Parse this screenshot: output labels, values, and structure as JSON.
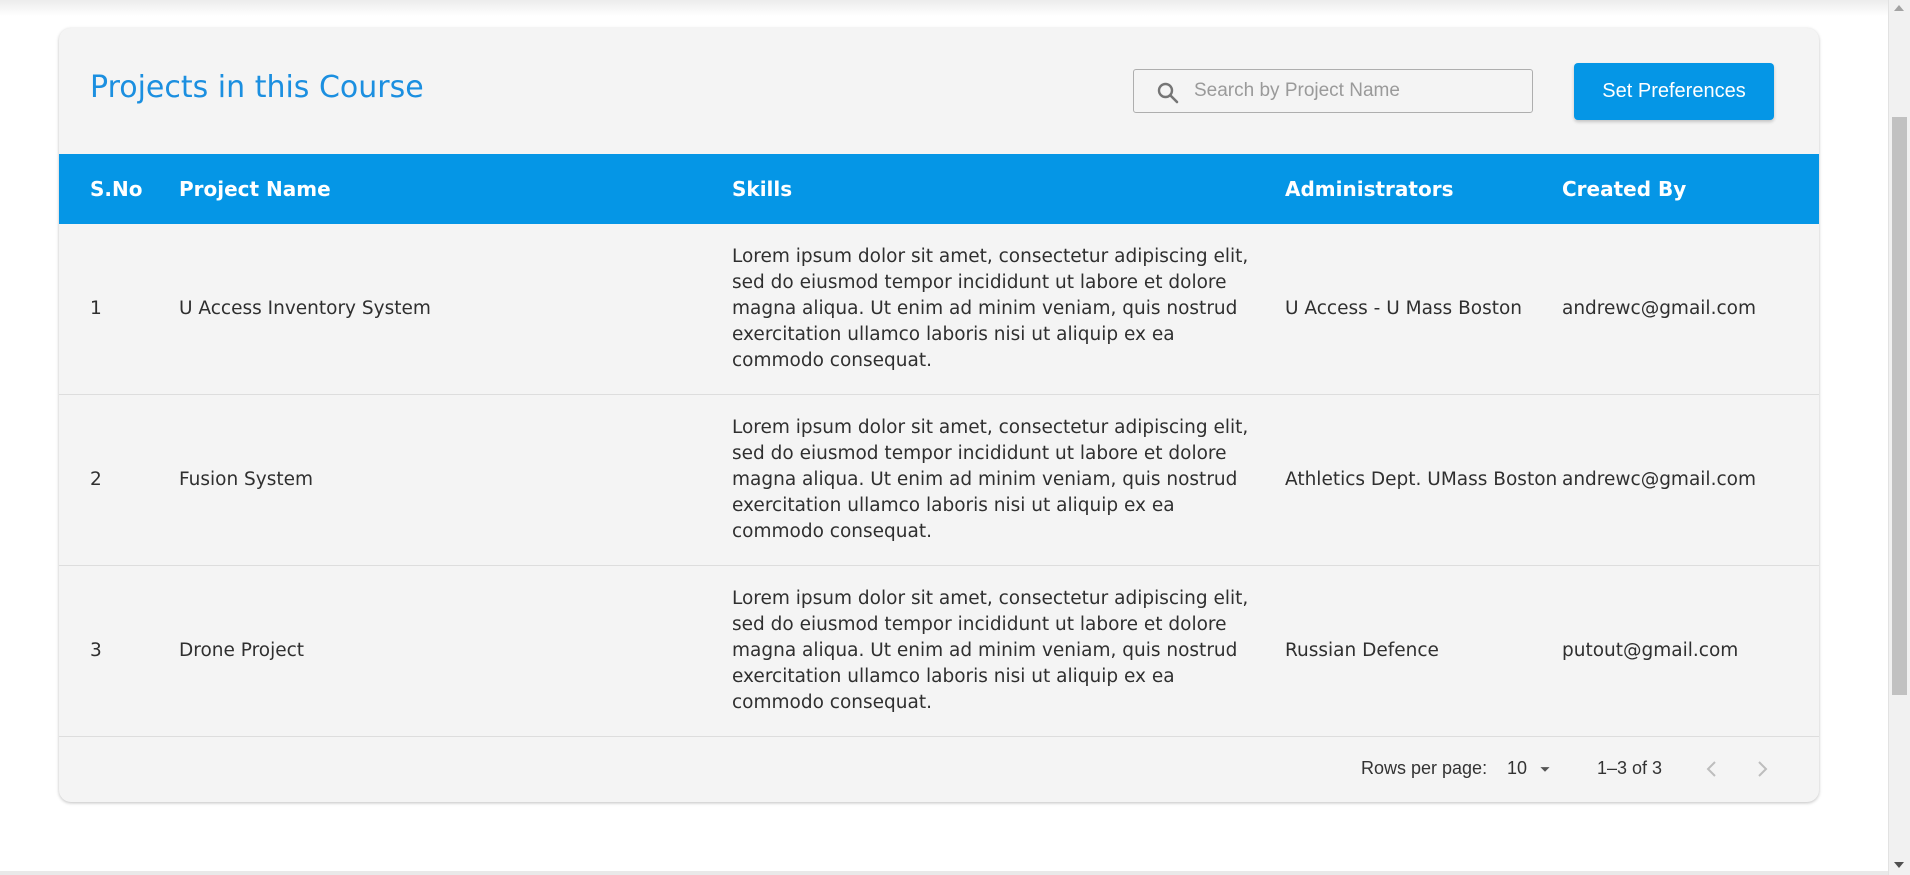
{
  "header": {
    "title": "Projects in this Course",
    "search_placeholder": "Search by Project Name",
    "search_value": "",
    "preferences_button": "Set Preferences"
  },
  "table": {
    "columns": [
      "S.No",
      "Project Name",
      "Skills",
      "Administrators",
      "Created By"
    ],
    "rows": [
      {
        "sno": "1",
        "project_name": "U Access Inventory System",
        "skills": "Lorem ipsum dolor sit amet, consectetur adipiscing elit, sed do eiusmod tempor incididunt ut labore et dolore magna aliqua. Ut enim ad minim veniam, quis nostrud exercitation ullamco laboris nisi ut aliquip ex ea commodo consequat.",
        "administrators": "U Access - U Mass Boston",
        "created_by": "andrewc@gmail.com"
      },
      {
        "sno": "2",
        "project_name": "Fusion System",
        "skills": "Lorem ipsum dolor sit amet, consectetur adipiscing elit, sed do eiusmod tempor incididunt ut labore et dolore magna aliqua. Ut enim ad minim veniam, quis nostrud exercitation ullamco laboris nisi ut aliquip ex ea commodo consequat.",
        "administrators": "Athletics Dept. UMass Boston",
        "created_by": "andrewc@gmail.com"
      },
      {
        "sno": "3",
        "project_name": "Drone Project",
        "skills": "Lorem ipsum dolor sit amet, consectetur adipiscing elit, sed do eiusmod tempor incididunt ut labore et dolore magna aliqua. Ut enim ad minim veniam, quis nostrud exercitation ullamco laboris nisi ut aliquip ex ea commodo consequat.",
        "administrators": "Russian Defence",
        "created_by": "putout@gmail.com"
      }
    ]
  },
  "pagination": {
    "rows_per_page_label": "Rows per page:",
    "rows_per_page_value": "10",
    "range_text": "1–3 of 3"
  },
  "icons": {
    "search": "search-icon",
    "dropdown": "arrow-drop-down-icon",
    "prev": "chevron-left-icon",
    "next": "chevron-right-icon"
  },
  "colors": {
    "accent": "#0596e6",
    "title": "#1b8fe0",
    "card_background": "#f4f4f4"
  }
}
